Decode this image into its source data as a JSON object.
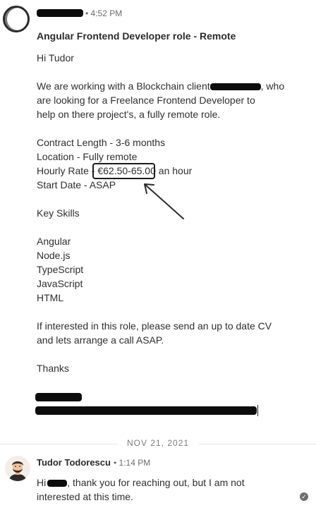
{
  "message1": {
    "time": "4:52 PM",
    "subject": "Angular Frontend Developer role - Remote",
    "body": {
      "greeting": "Hi Tudor",
      "p1_line1_a": "We are working with a Blockchain client",
      "p1_line1_b": ", who",
      "p1_line2": "are looking for a Freelance Frontend Developer to",
      "p1_line3": "help on there project's, a fully remote role.",
      "contract": "Contract Length - 3-6 months",
      "location": "Location - Fully remote",
      "rate_prefix": "Hourly Rate - ",
      "rate_value": "€62.50-65.00",
      "rate_suffix": " an hour",
      "start": "Start Date - ASAP",
      "key_skills": "Key Skills",
      "skills": [
        "Angular",
        "Node.js",
        "TypeScript",
        "JavaScript",
        "HTML"
      ],
      "closing1": "If interested in this role, please send an up to date CV",
      "closing2": "and lets arrange a call ASAP.",
      "thanks": "Thanks"
    }
  },
  "date_separator": "NOV 21, 2021",
  "message2": {
    "sender": "Tudor Todorescu",
    "time": "1:14 PM",
    "line1_a": "Hi",
    "line1_b": ", thank you for reaching out, but I am not",
    "line2": "interested at this time."
  },
  "icons": {
    "read_receipt": "check-circle-icon",
    "annotation": "hand-drawn-arrow"
  }
}
